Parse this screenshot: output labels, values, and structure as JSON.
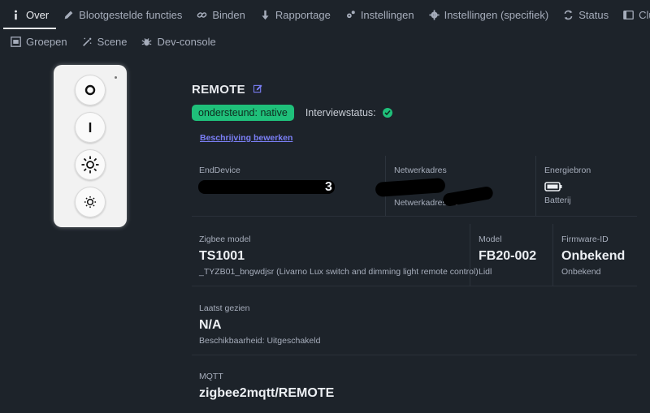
{
  "tabs": [
    {
      "label": "Over",
      "icon": "info-icon",
      "active": true
    },
    {
      "label": "Blootgestelde functies",
      "icon": "pencil-icon"
    },
    {
      "label": "Binden",
      "icon": "link-icon"
    },
    {
      "label": "Rapportage",
      "icon": "download-arrow-icon"
    },
    {
      "label": "Instellingen",
      "icon": "cogs-icon"
    },
    {
      "label": "Instellingen (specifiek)",
      "icon": "gear-icon"
    },
    {
      "label": "Status",
      "icon": "sync-icon"
    },
    {
      "label": "Clusters",
      "icon": "clusters-icon"
    }
  ],
  "tabs2": [
    {
      "label": "Groepen",
      "icon": "groups-icon"
    },
    {
      "label": "Scene",
      "icon": "magic-wand-icon"
    },
    {
      "label": "Dev-console",
      "icon": "bug-icon"
    }
  ],
  "device": {
    "title": "REMOTE",
    "support_badge": "ondersteund: native",
    "interview_label": "Interviewstatus:",
    "edit_description": "Beschrijving bewerken"
  },
  "info": {
    "enddevice_label": "EndDevice",
    "network_label": "Netwerkadres",
    "network_sub": "Netwerkadres de",
    "power_label": "Energiebron",
    "power_sub": "Batterij",
    "zigbee_label": "Zigbee model",
    "zigbee_value": "TS1001",
    "zigbee_sub": "_TYZB01_bngwdjsr (Livarno Lux switch and dimming light remote control)",
    "model_label": "Model",
    "model_value": "FB20-002",
    "model_sub": "Lidl",
    "firmware_label": "Firmware-ID",
    "firmware_value": "Onbekend",
    "firmware_sub": "Onbekend",
    "lastseen_label": "Laatst gezien",
    "lastseen_value": "N/A",
    "lastseen_sub": "Beschikbaarheid: Uitgeschakeld",
    "mqtt_label": "MQTT",
    "mqtt_value": "zigbee2mqtt/REMOTE"
  },
  "colors": {
    "accent": "#1fc07a",
    "link": "#7b7ff6",
    "background": "#1d232a"
  }
}
